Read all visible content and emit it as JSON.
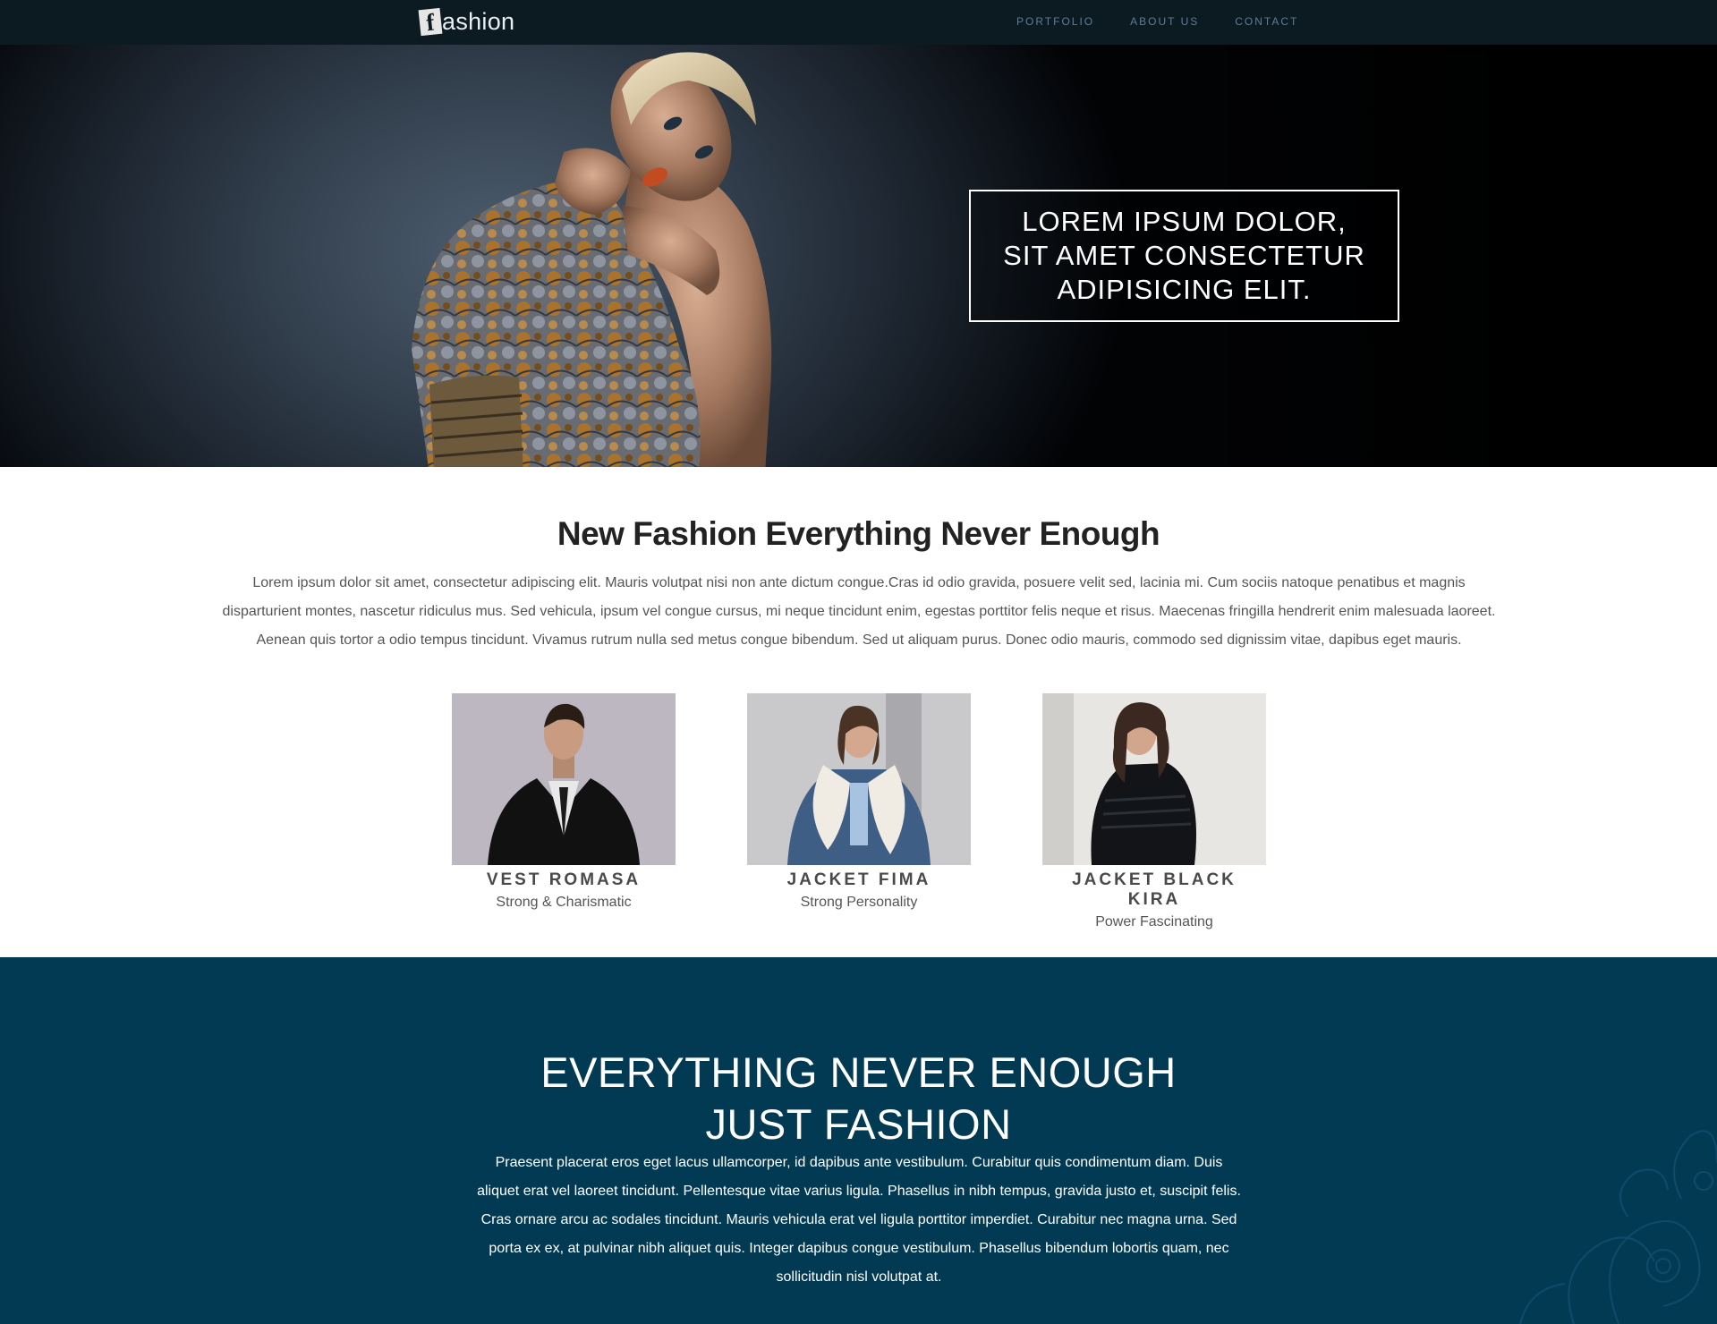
{
  "brand": {
    "logo_letter": "f",
    "logo_rest": "ashion"
  },
  "nav": {
    "items": [
      {
        "label": "PORTFOLIO"
      },
      {
        "label": "ABOUT US"
      },
      {
        "label": "CONTACT"
      }
    ]
  },
  "hero": {
    "headline": "LOREM IPSUM DOLOR, SIT AMET CONSECTETUR ADIPISICING ELIT."
  },
  "intro": {
    "title": "New Fashion Everything Never Enough",
    "text": "Lorem ipsum dolor sit amet, consectetur adipiscing elit. Mauris volutpat nisi non ante dictum congue.Cras id odio gravida, posuere velit sed, lacinia mi. Cum sociis natoque penatibus et magnis disparturient montes, nascetur ridiculus mus. Sed vehicula, ipsum vel congue cursus, mi neque tincidunt enim, egestas porttitor felis neque et risus. Maecenas fringilla hendrerit enim malesuada laoreet. Aenean quis tortor a odio tempus tincidunt. Vivamus rutrum nulla sed metus congue bibendum. Sed ut aliquam purus. Donec odio mauris, commodo sed dignissim vitae, dapibus eget mauris."
  },
  "products": [
    {
      "name": "VEST ROMASA",
      "subtitle": "Strong & Charismatic"
    },
    {
      "name": "JACKET FIMA",
      "subtitle": "Strong Personality"
    },
    {
      "name": "JACKET BLACK KIRA",
      "subtitle": "Power Fascinating"
    }
  ],
  "feature": {
    "title_line1": "EVERYTHING NEVER ENOUGH",
    "title_line2": "JUST FASHION",
    "text": "Praesent placerat eros eget lacus ullamcorper, id dapibus ante vestibulum. Curabitur quis condimentum diam. Duis aliquet erat vel laoreet tincidunt. Pellentesque vitae varius ligula. Phasellus in nibh tempus, gravida justo et, suscipit felis. Cras ornare arcu ac sodales tincidunt. Mauris vehicula erat vel ligula porttitor imperdiet. Curabitur nec magna urna. Sed porta ex ex, at pulvinar nibh aliquet quis. Integer dapibus congue vestibulum. Phasellus bibendum lobortis quam, nec sollicitudin nisl volutpat at."
  },
  "colors": {
    "navbar": "#0c1a22",
    "nav_link": "#5e7e95",
    "feature_bg": "#023a53",
    "heading": "#222222",
    "body_text": "#555555"
  },
  "icons": {
    "logo": "f-letter-logo-icon",
    "pattern": "paisley-pattern"
  }
}
